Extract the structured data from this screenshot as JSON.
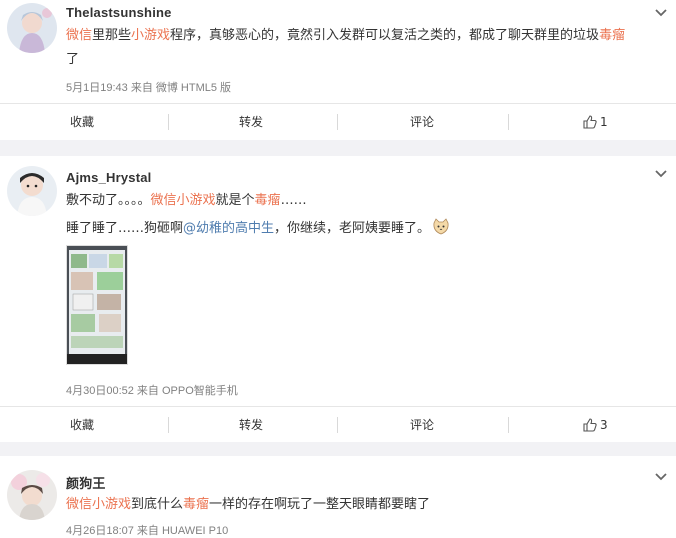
{
  "comments": [
    {
      "username": "Thelastsunshine",
      "segments": [
        {
          "text": "微信",
          "kind": "kw"
        },
        {
          "text": "里那些",
          "kind": "plain"
        },
        {
          "text": "小游戏",
          "kind": "kw"
        },
        {
          "text": "程序，真够恶心的，竟然引入发群可以复活之类的，都成了聊天群里的垃圾",
          "kind": "plain"
        },
        {
          "text": "毒瘤",
          "kind": "kw"
        }
      ],
      "line2": "了",
      "meta": "5月1日19:43 来自 微博 HTML5 版",
      "actions": {
        "collect": "收藏",
        "repost": "转发",
        "comment": "评论",
        "like_count": "1"
      }
    },
    {
      "username": "Ajms_Hrystal",
      "line1a": "敷不动了。。。。",
      "line1_kw1": "微信小游戏",
      "line1b": "就是个",
      "line1_kw2": "毒瘤",
      "line1c": "……",
      "line2a": "睡了睡了……狗砸啊",
      "mention": "@幼稚的高中生",
      "line2b": "，你继续，老阿姨要睡了。",
      "meta": "4月30日00:52 来自 OPPO智能手机",
      "actions": {
        "collect": "收藏",
        "repost": "转发",
        "comment": "评论",
        "like_count": "3"
      }
    },
    {
      "username": "颜狗王",
      "line1_kw1": "微信小游戏",
      "line1a": "到底什么",
      "line1_kw2": "毒瘤",
      "line1b": "一样的存在啊玩了一整天眼睛都要瞎了",
      "meta": "4月26日18:07 来自 HUAWEI P10"
    }
  ],
  "colors": {
    "keyword": "#eb7350",
    "mention": "#507daf",
    "meta": "#808080",
    "separator": "#f2f2f5"
  },
  "icons": [
    "chevron-down-icon",
    "thumbs-up-icon",
    "cat-emoji-icon"
  ]
}
